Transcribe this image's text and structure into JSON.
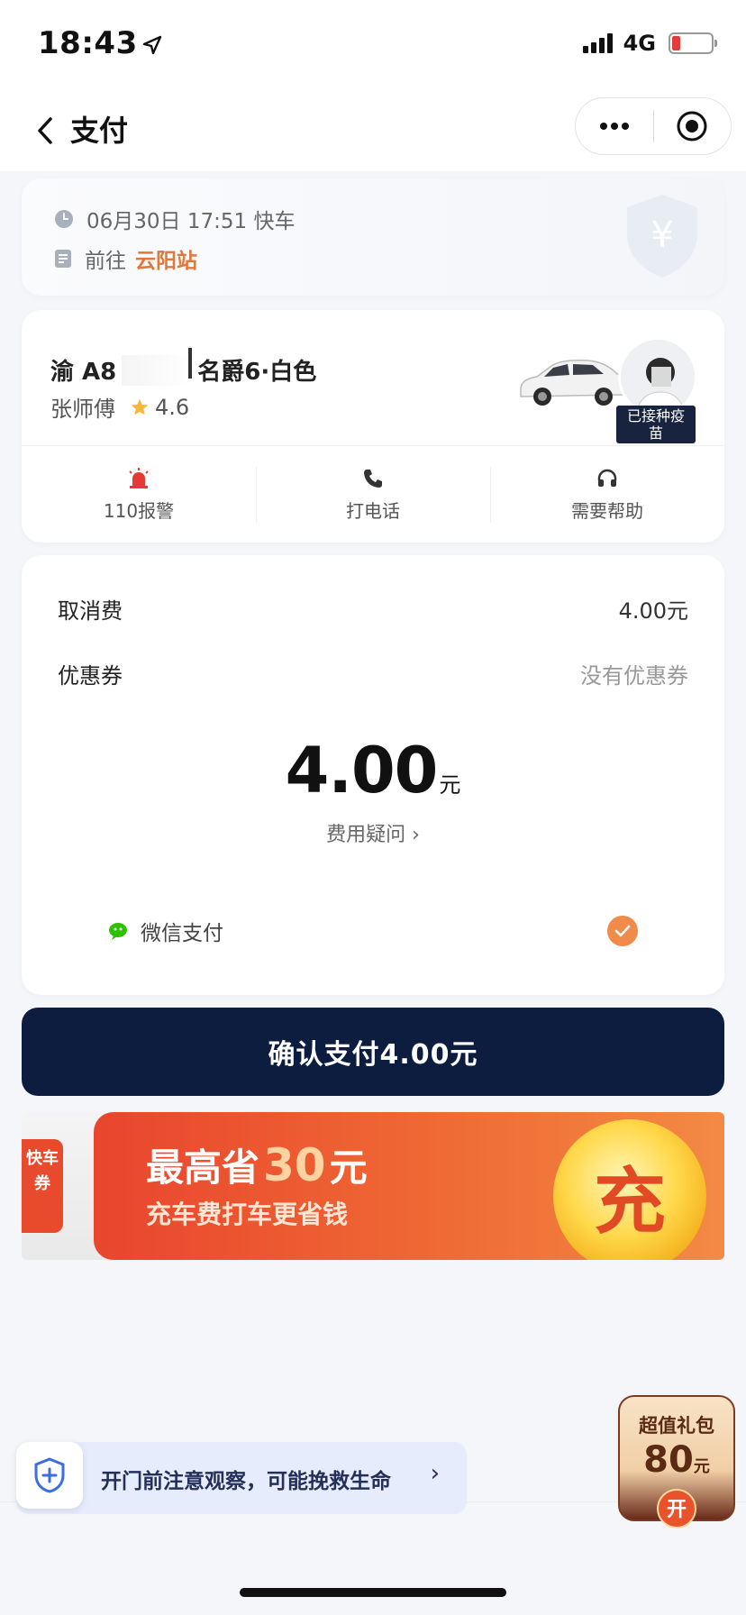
{
  "status_bar": {
    "time": "18:43",
    "network": "4G"
  },
  "nav": {
    "title": "支付"
  },
  "trip": {
    "datetime": "06月30日 17:51 快车",
    "to_prefix": "前往",
    "destination": "云阳站"
  },
  "driver": {
    "plate_prefix": "渝 A8",
    "car_model": "名爵6·白色",
    "name": "张师傅",
    "rating": "4.6",
    "vaccinated_badge_line1": "已接种疫",
    "vaccinated_badge_line2": "苗"
  },
  "actions": [
    {
      "label": "110报警",
      "icon": "alarm-icon"
    },
    {
      "label": "打电话",
      "icon": "phone-icon"
    },
    {
      "label": "需要帮助",
      "icon": "headset-icon"
    }
  ],
  "fees": {
    "cancel_label": "取消费",
    "cancel_value": "4.00元",
    "coupon_label": "优惠券",
    "coupon_value": "没有优惠券",
    "total_amount": "4.00",
    "total_unit": "元",
    "question": "费用疑问 ›"
  },
  "payment": {
    "method": "微信支付"
  },
  "confirm_button": "确认支付4.00元",
  "banner": {
    "ticket_text": "快车券",
    "title_prefix": "最高省",
    "title_amount": "30",
    "title_suffix": "元",
    "subtitle": "充车费打车更省钱",
    "coin_char": "充"
  },
  "safety_tip": {
    "text": "开门前注意观察，可能挽救生命",
    "arrow": "›"
  },
  "gift": {
    "title": "超值礼包",
    "amount": "80",
    "unit": "元",
    "open": "开"
  },
  "colors": {
    "accent": "#e0773b",
    "primary_button": "#0d1d3f",
    "check": "#f08b4a",
    "alarm": "#e53935"
  }
}
